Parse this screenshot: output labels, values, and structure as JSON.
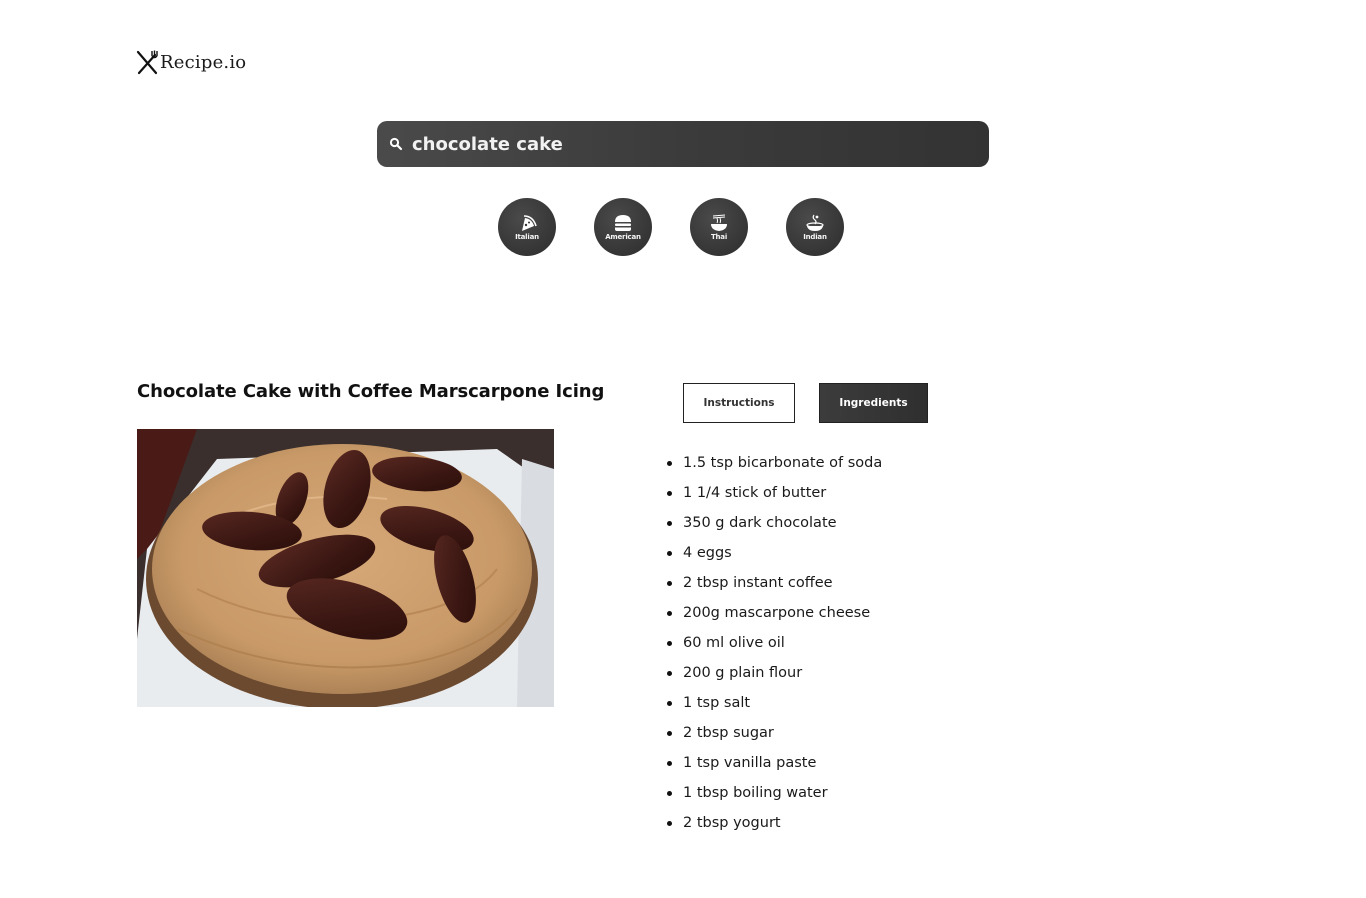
{
  "header": {
    "logo_text": "Recipe.io",
    "logo_icon": "fork-knife-icon"
  },
  "search": {
    "value": "chocolate cake",
    "placeholder": "",
    "icon": "search-icon"
  },
  "cuisines": [
    {
      "label": "Italian",
      "icon": "pizza-slice-icon"
    },
    {
      "label": "American",
      "icon": "burger-icon"
    },
    {
      "label": "Thai",
      "icon": "noodle-bowl-icon"
    },
    {
      "label": "Indian",
      "icon": "curry-bowl-icon"
    }
  ],
  "recipe": {
    "title": "Chocolate Cake with Coffee Marscarpone Icing",
    "image_alt": "Chocolate cake topped with coffee mascarpone icing and chocolate leaves",
    "tabs": [
      {
        "label": "Instructions",
        "active": false
      },
      {
        "label": "Ingredients",
        "active": true
      }
    ],
    "ingredients": [
      "1.5 tsp bicarbonate of soda",
      "1 1/4 stick of butter",
      "350 g dark chocolate",
      "4 eggs",
      "2 tbsp instant coffee",
      "200g mascarpone cheese",
      "60 ml olive oil",
      "200 g plain flour",
      "1 tsp salt",
      "2 tbsp sugar",
      "1 tsp vanilla paste",
      "1 tbsp boiling water",
      "2 tbsp yogurt"
    ]
  },
  "colors": {
    "dark_accent": "#333333",
    "background": "#ffffff",
    "text": "#111111"
  }
}
